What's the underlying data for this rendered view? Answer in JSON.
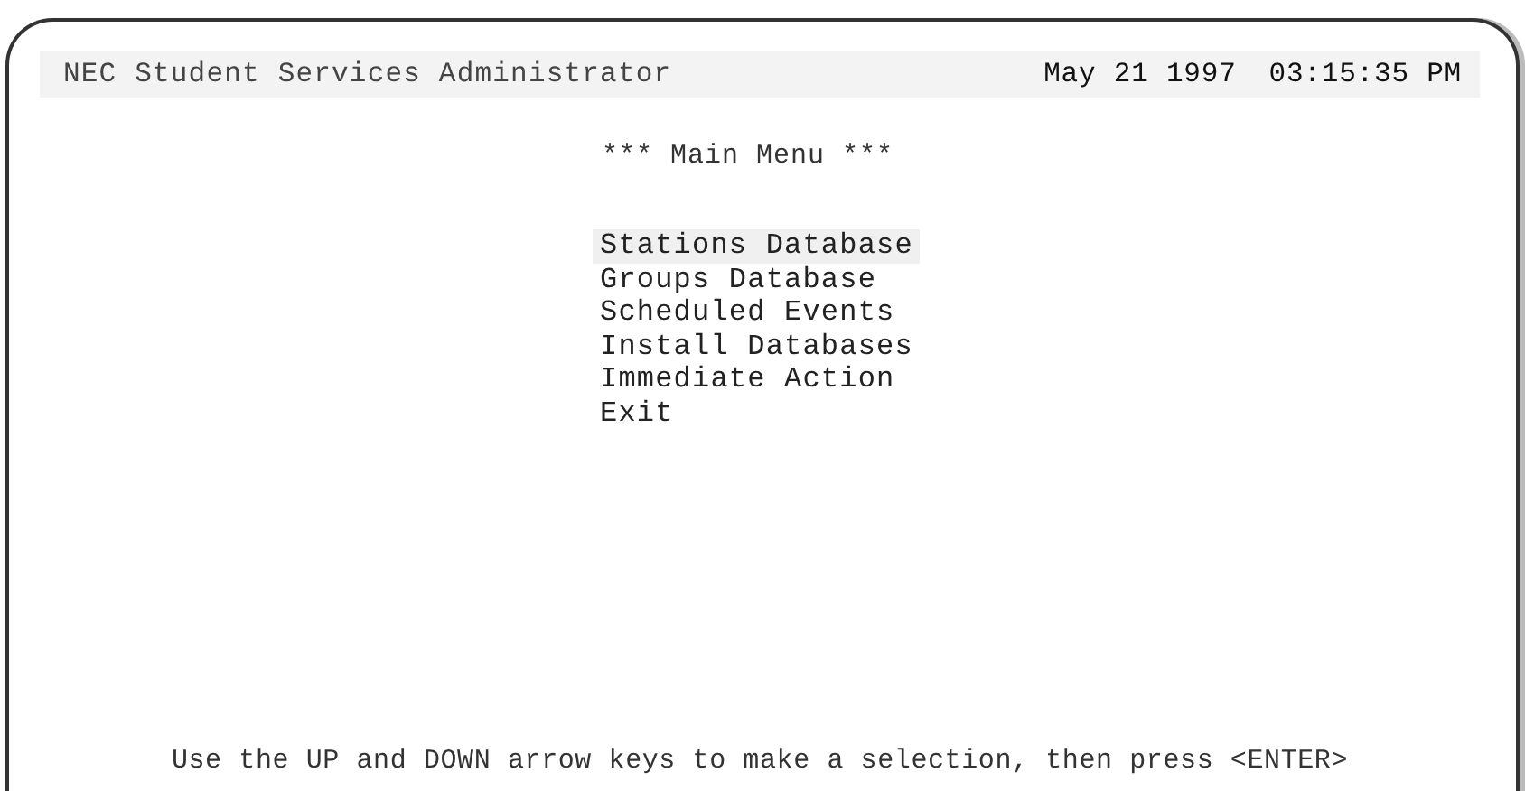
{
  "header": {
    "title": "NEC Student Services Administrator",
    "date": "May 21 1997",
    "time": "03:15:35 PM"
  },
  "menu": {
    "title": "*** Main Menu ***",
    "items": [
      {
        "label": "Stations Database",
        "selected": true
      },
      {
        "label": "Groups Database",
        "selected": false
      },
      {
        "label": "Scheduled Events",
        "selected": false
      },
      {
        "label": "Install Databases",
        "selected": false
      },
      {
        "label": "Immediate Action",
        "selected": false
      },
      {
        "label": "Exit",
        "selected": false
      }
    ]
  },
  "status_line": "Use the UP and DOWN arrow keys to make a selection, then press <ENTER>"
}
